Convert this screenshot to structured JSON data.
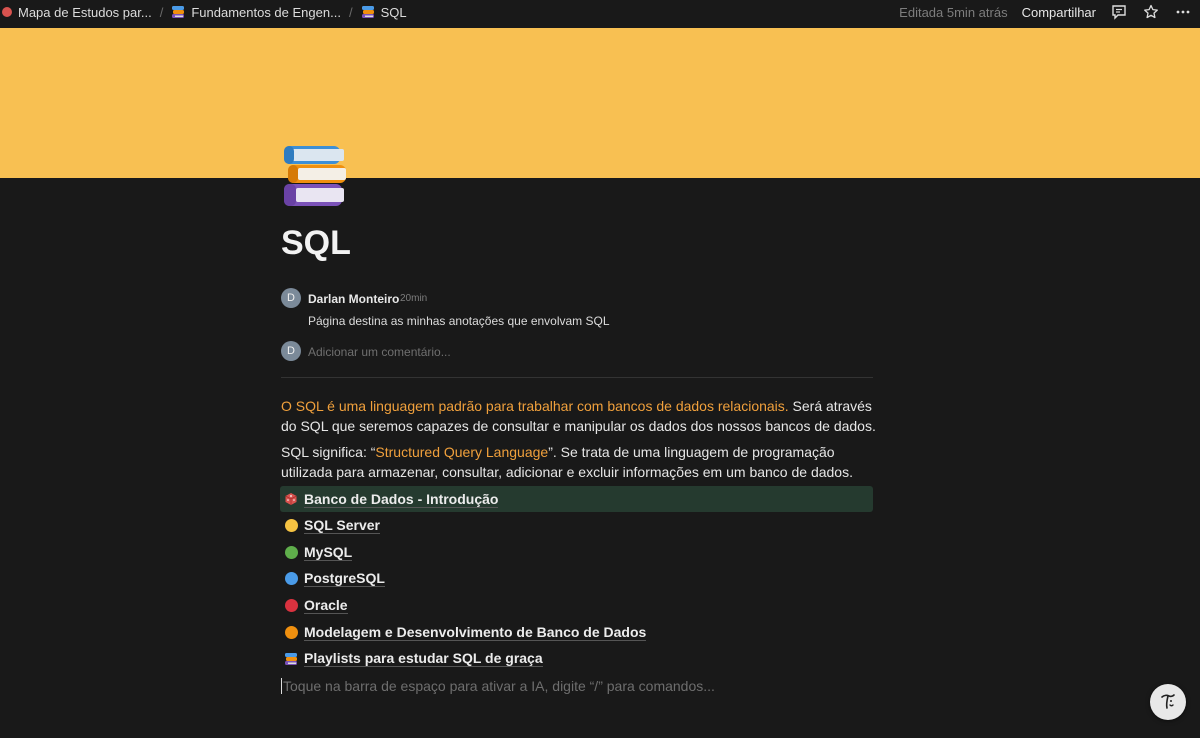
{
  "breadcrumbs": [
    {
      "label": "Mapa de Estudos par...",
      "icon": "red-circle-icon"
    },
    {
      "label": "Fundamentos de Engen...",
      "icon": "books-icon"
    },
    {
      "label": "SQL",
      "icon": "books-icon"
    }
  ],
  "topbar": {
    "edited": "Editada 5min atrás",
    "share": "Compartilhar"
  },
  "page": {
    "title": "SQL",
    "cover_color": "#f8c052",
    "icon": "books-icon"
  },
  "comment": {
    "avatar_letter": "D",
    "author": "Darlan Monteiro",
    "time": "20min",
    "text": "Página destina as minhas anotações que envolvam SQL",
    "add_placeholder": "Adicionar um comentário..."
  },
  "content": {
    "p1_highlight": "O SQL é uma linguagem padrão para trabalhar com bancos de dados relacionais.",
    "p1_rest": " Será através do SQL que seremos capazes de consultar e manipular os dados dos nossos bancos de dados.",
    "p2_before": "SQL significa: “",
    "p2_highlight": "Structured Query Language",
    "p2_after": "”. Se trata de uma linguagem de programação utilizada para armazenar, consultar, adicionar e excluir informações em um banco de dados."
  },
  "links": [
    {
      "label": "Banco de Dados - Introdução",
      "icon": "dice-icon",
      "color": "#d9534f"
    },
    {
      "label": "SQL Server",
      "icon": "yellow-circle-icon",
      "color": "#f5c242"
    },
    {
      "label": "MySQL",
      "icon": "green-circle-icon",
      "color": "#5fae4b"
    },
    {
      "label": "PostgreSQL",
      "icon": "blue-circle-icon",
      "color": "#4a9be8"
    },
    {
      "label": "Oracle",
      "icon": "red-circle-icon",
      "color": "#d9323f"
    },
    {
      "label": "Modelagem e Desenvolvimento de Banco de Dados",
      "icon": "orange-circle-icon",
      "color": "#f0900f"
    },
    {
      "label": "Playlists para estudar SQL de graça",
      "icon": "books-icon",
      "color": "#4a9be8"
    }
  ],
  "prompt": "Toque na barra de espaço para ativar a IA, digite “/” para comandos..."
}
